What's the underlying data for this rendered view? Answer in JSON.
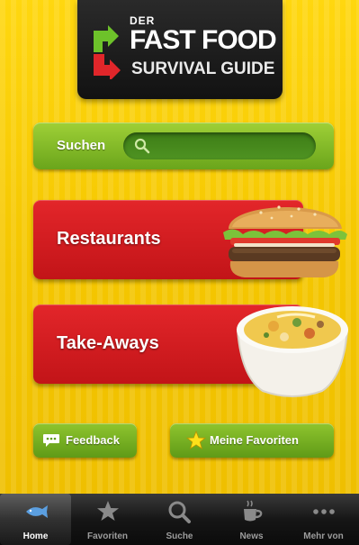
{
  "header": {
    "der": "DER",
    "fast_food": "FAST FOOD",
    "survival_guide": "SURVIVAL GUIDE"
  },
  "search": {
    "label": "Suchen",
    "value": ""
  },
  "categories": [
    {
      "label": "Restaurants",
      "image_icon": "burger-image"
    },
    {
      "label": "Take-Aways",
      "image_icon": "soup-bowl-image"
    }
  ],
  "actions": {
    "feedback_label": "Feedback",
    "favorites_label": "Meine Favoriten"
  },
  "tabbar": {
    "items": [
      {
        "label": "Home",
        "icon": "fish-icon",
        "active": true
      },
      {
        "label": "Favoriten",
        "icon": "star-icon",
        "active": false
      },
      {
        "label": "Suche",
        "icon": "search-icon",
        "active": false
      },
      {
        "label": "News",
        "icon": "coffee-cup-icon",
        "active": false
      },
      {
        "label": "Mehr von",
        "icon": "ellipsis-icon",
        "active": false
      }
    ]
  },
  "colors": {
    "background": "#f6cf0a",
    "accent_green": "#7db826",
    "accent_red": "#d41d21",
    "header_dark": "#1c1c1c"
  }
}
